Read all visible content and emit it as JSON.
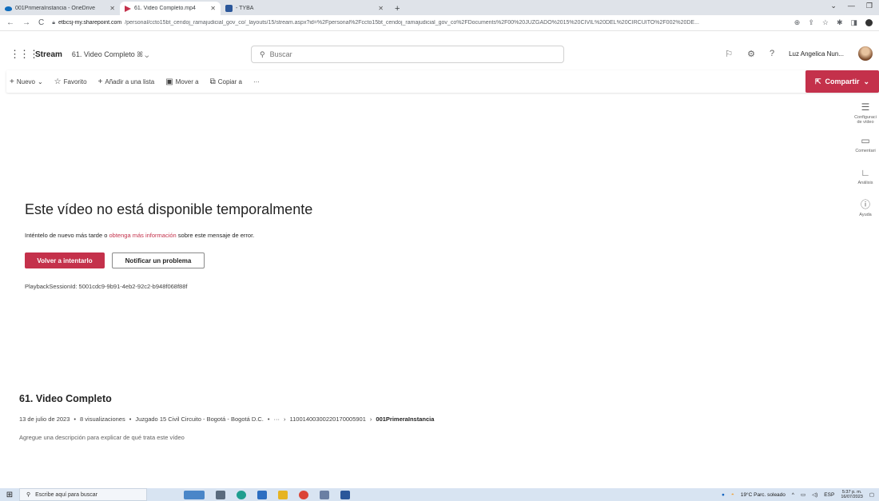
{
  "browser": {
    "tabs": [
      {
        "label": "001PrimeraInstancia - OneDrive",
        "icon": "onedrive-icon"
      },
      {
        "label": "61. Video Completo.mp4",
        "icon": "stream-icon"
      },
      {
        "label": "- TYBA",
        "icon": "tyba-icon"
      }
    ],
    "new_tab": "+",
    "url_host": "etbcsj-my.sharepoint.com",
    "url_path": "/personal/ccto15bt_cendoj_ramajudicial_gov_co/_layouts/15/stream.aspx?id=%2Fpersonal%2Fccto15bt_cendoj_ramajudicial_gov_co%2FDocuments%2F00%20JUZGADO%2015%20CIVIL%20DEL%20CIRCUITO%2F002%20DE..."
  },
  "app": {
    "brand": "Stream",
    "breadcrumb": "61. Video Completo",
    "search_placeholder": "Buscar",
    "user_name": "Luz Angelica Nun..."
  },
  "commands": {
    "new": "Nuevo",
    "favorite": "Favorito",
    "add_list": "Añadir a una lista",
    "move": "Mover a",
    "copy": "Copiar a",
    "more": "···",
    "share": "Compartir"
  },
  "error": {
    "title": "Este vídeo no está disponible temporalmente",
    "msg_prefix": "Inténtelo de nuevo más tarde o ",
    "msg_link": "obtenga más información",
    "msg_suffix": " sobre este mensaje de error.",
    "retry": "Volver a intentarlo",
    "report": "Notificar un problema",
    "session": "PlaybackSessionId: 5001cdc9-9b91-4eb2-92c2-b948f068f88f"
  },
  "rail": [
    {
      "label": "Configuraci de vídeo",
      "icon": "video-settings-icon"
    },
    {
      "label": "Comentari",
      "icon": "comments-icon"
    },
    {
      "label": "Análisis",
      "icon": "analytics-icon"
    },
    {
      "label": "Ayuda",
      "icon": "help-icon"
    }
  ],
  "video": {
    "title": "61. Video Completo",
    "date": "13 de julio de 2023",
    "views": "8 visualizaciones",
    "owner": "Juzgado 15 Civil Circuito - Bogotá - Bogotá D.C.",
    "ellipsis": "···",
    "folder1": "11001400300220170005901",
    "folder2": "001PrimeraInstancia",
    "description_placeholder": "Agregue una descripción para explicar de qué trata este vídeo"
  },
  "taskbar": {
    "search_placeholder": "Escribe aquí para buscar",
    "weather": "19°C  Parc. soleado",
    "lang": "ESP",
    "time": "5:37 p. m.",
    "date": "16/07/2023"
  },
  "colors": {
    "accent": "#c4314b",
    "taskbar": "#d8e4f2"
  }
}
